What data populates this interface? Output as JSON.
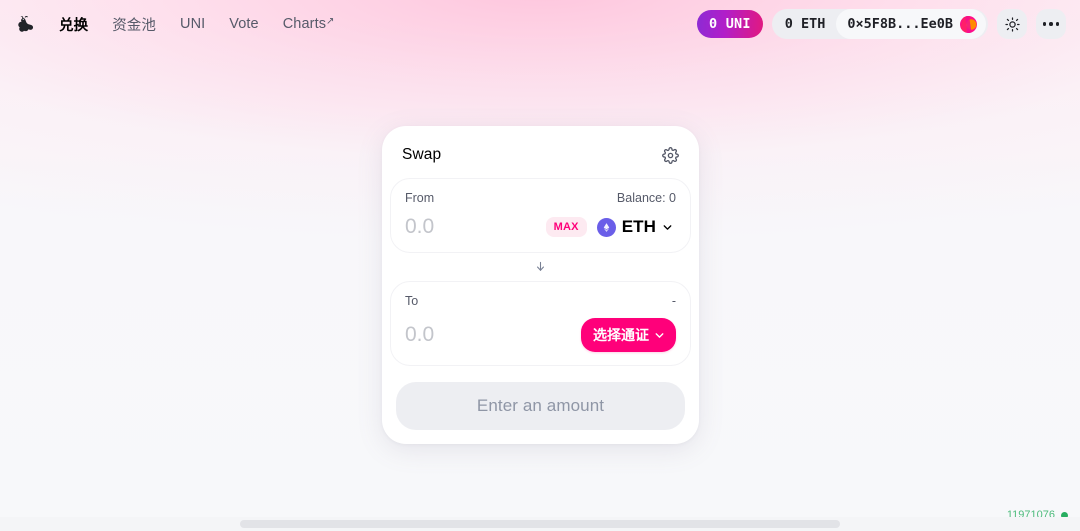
{
  "navbar": {
    "logo_icon": "unicorn-logo",
    "links": [
      {
        "label": "兑换",
        "active": true,
        "external": false
      },
      {
        "label": "资金池",
        "active": false,
        "external": false
      },
      {
        "label": "UNI",
        "active": false,
        "external": false
      },
      {
        "label": "Vote",
        "active": false,
        "external": false
      },
      {
        "label": "Charts",
        "active": false,
        "external": true,
        "external_glyph": "↗"
      }
    ],
    "uni_balance": "0 UNI",
    "eth_balance": "0 ETH",
    "account_address": "0×5F8B...Ee0B",
    "theme_toggle_icon": "sun-icon",
    "more_menu_icon": "dots-icon"
  },
  "swap": {
    "title": "Swap",
    "settings_icon": "gear-icon",
    "from": {
      "label": "From",
      "balance_label": "Balance: 0",
      "amount_value": "",
      "amount_placeholder": "0.0",
      "max_label": "MAX",
      "token_symbol": "ETH",
      "token_logo_icon": "ethereum-icon",
      "chevron_icon": "chevron-down-icon"
    },
    "swap_direction_icon": "arrow-down-icon",
    "to": {
      "label": "To",
      "balance_label": "-",
      "amount_value": "",
      "amount_placeholder": "0.0",
      "select_token_label": "选择通证",
      "chevron_icon": "chevron-down-icon"
    },
    "cta_label": "Enter an amount"
  },
  "status": {
    "block_number": "11971076"
  },
  "colors": {
    "accent_pink": "#ff007a",
    "uni_gradient_start": "#8c2bd4",
    "uni_gradient_end": "#e2197f",
    "block_green": "#27ae60",
    "eth_purple": "#6a5ee8"
  }
}
